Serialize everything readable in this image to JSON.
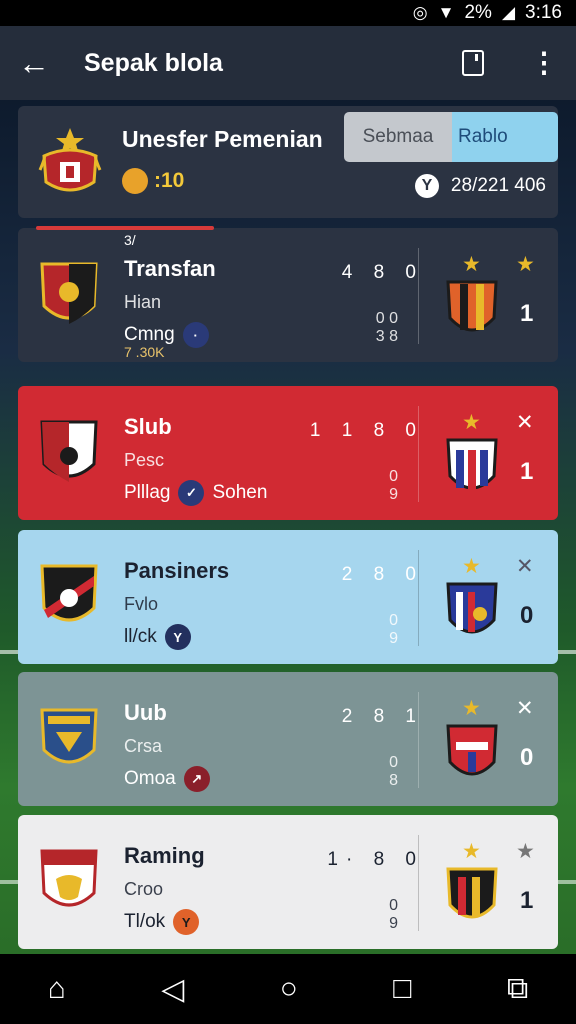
{
  "status_bar": {
    "battery": "2%",
    "time": "3:16"
  },
  "app_bar": {
    "title": "Sepak blola"
  },
  "header": {
    "title": "Unesfer Pemenian",
    "subtitle": ":10",
    "toggle_option_1": "Sebmaa",
    "toggle_option_2": "Rablo",
    "info": "28/221 406"
  },
  "rows": [
    {
      "superscript": "3/",
      "name": "Transfan",
      "line2": "Hian",
      "line3": "Cmng",
      "note": "7 .30K",
      "stats": "4 8 0",
      "stats2": "0 0\n3 8",
      "score": "1",
      "colors": {
        "bg": "#2b3342"
      }
    },
    {
      "name": "Slub",
      "line2": "Pesc",
      "line3": "Plllag",
      "line3b": "Sohen",
      "stats": "1 1 8 0",
      "stats2": "0\n9",
      "score": "1",
      "colors": {
        "bg": "#d12a33"
      }
    },
    {
      "name": "Pansiners",
      "line2": "Fvlo",
      "line3": "ll/ck",
      "stats": "2 8 0",
      "stats2": "0\n9",
      "score": "0",
      "colors": {
        "bg": "#a6d6ee"
      }
    },
    {
      "name": "Uub",
      "line2": "Crsa",
      "line3": "Omoa",
      "stats": "2 8 1",
      "stats2": "0\n8",
      "score": "0",
      "colors": {
        "bg": "#7d9495"
      }
    },
    {
      "name": "Raming",
      "line2": "Croo",
      "line3": "Tl/ok",
      "stats": "1· 8 0",
      "stats2": "0\n9",
      "score": "1",
      "colors": {
        "bg": "#ededee"
      }
    }
  ]
}
